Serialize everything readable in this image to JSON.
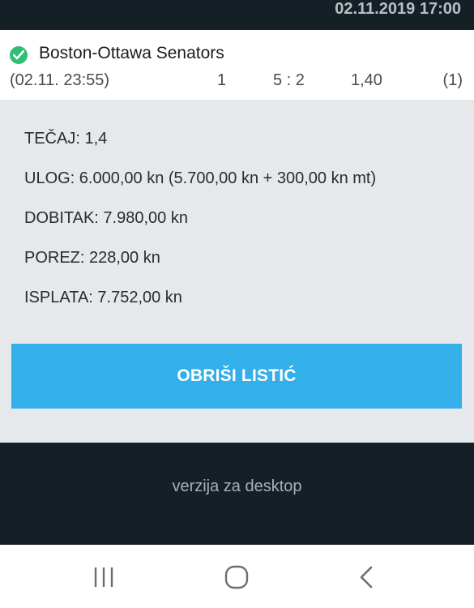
{
  "status_bar": {
    "datetime": "02.11.2019 17:00"
  },
  "bet": {
    "match": "Boston-Ottawa Senators",
    "datetime": "(02.11. 23:55)",
    "pick": "1",
    "score": "5 : 2",
    "odd": "1,40",
    "count": "(1)",
    "status_icon": "check-circle-icon",
    "status_color": "#2fbf71"
  },
  "summary": {
    "tecaj": "TEČAJ: 1,4",
    "ulog": "ULOG: 6.000,00 kn (5.700,00 kn + 300,00 kn mt)",
    "dobitak": "DOBITAK: 7.980,00 kn",
    "porez": "POREZ: 228,00 kn",
    "isplata": "ISPLATA: 7.752,00 kn"
  },
  "actions": {
    "delete_label": "OBRIŠI LISTIĆ",
    "accent": "#33b0ea"
  },
  "footer": {
    "desktop_link": "verzija za desktop"
  },
  "nav": {
    "recents_icon": "recents-icon",
    "home_icon": "home-icon",
    "back_icon": "back-icon"
  }
}
